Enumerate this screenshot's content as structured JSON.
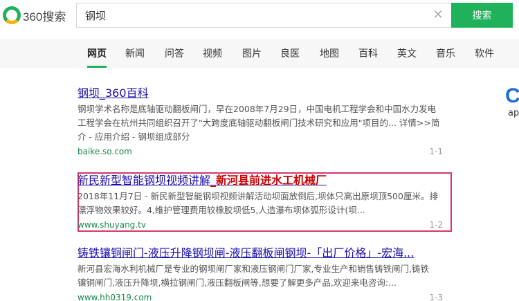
{
  "logo": {
    "text": "360搜索"
  },
  "search": {
    "query": "钢坝",
    "button_label": "搜索"
  },
  "nav": [
    "网页",
    "新闻",
    "问答",
    "视频",
    "图片",
    "良医",
    "地图",
    "百科",
    "英文",
    "音乐",
    "软件"
  ],
  "results": [
    {
      "title": "钢坝_360百科",
      "desc1": "钢坝学术名称是底轴驱动翻板闸门，早在2008年7月29日，中国电机工程学会和中国水力发电",
      "desc2": "工程学会在杭州共同组织召开了\"大跨度底轴驱动翻板闸门技术研究和应用\"项目的... 详情>>简",
      "desc3": "介 - 应用介绍 - 钢坝组成部分",
      "url": "baike.so.com",
      "num": "1-1"
    },
    {
      "title_a": "新民新型智能钢坝视频讲解",
      "title_b": "_新河县前进水工机械厂",
      "desc1": "2018年11月7日 - 新民新型智能钢坝视频讲解活动坝面放倒后,坝体只高出原坝顶500厘米。排",
      "desc2": "漂浮物效果较好。4,维护管理费用较橡胶坝低5,人造瀑布坝体弧形设计(坝...",
      "url": "www.shuyang.tv",
      "num": "1-2"
    },
    {
      "title": "铸铁镶铜闸门-液压升降钢坝闸-液压翻板闸钢坝-「出厂价格」-宏海...",
      "desc1": "新河县宏海水利机械厂是专业的钢坝闸厂家和液压钢闸门厂家,专业生产和销售铸铁闸门,铸铁",
      "desc2": "镶铜闸门,液压升降坝,横拉钢闸门,液压翻板闸等,想要了解更多产品,欢迎来电咨询:...",
      "url": "www.hh0319.com",
      "num": "1-3"
    }
  ],
  "side": {
    "logo": "C",
    "text": "ap"
  },
  "colors": {
    "brand_green": "#1fb25a",
    "link_blue": "#1a0dab",
    "url_green": "#198a4b",
    "highlight_border": "#d4376c"
  }
}
